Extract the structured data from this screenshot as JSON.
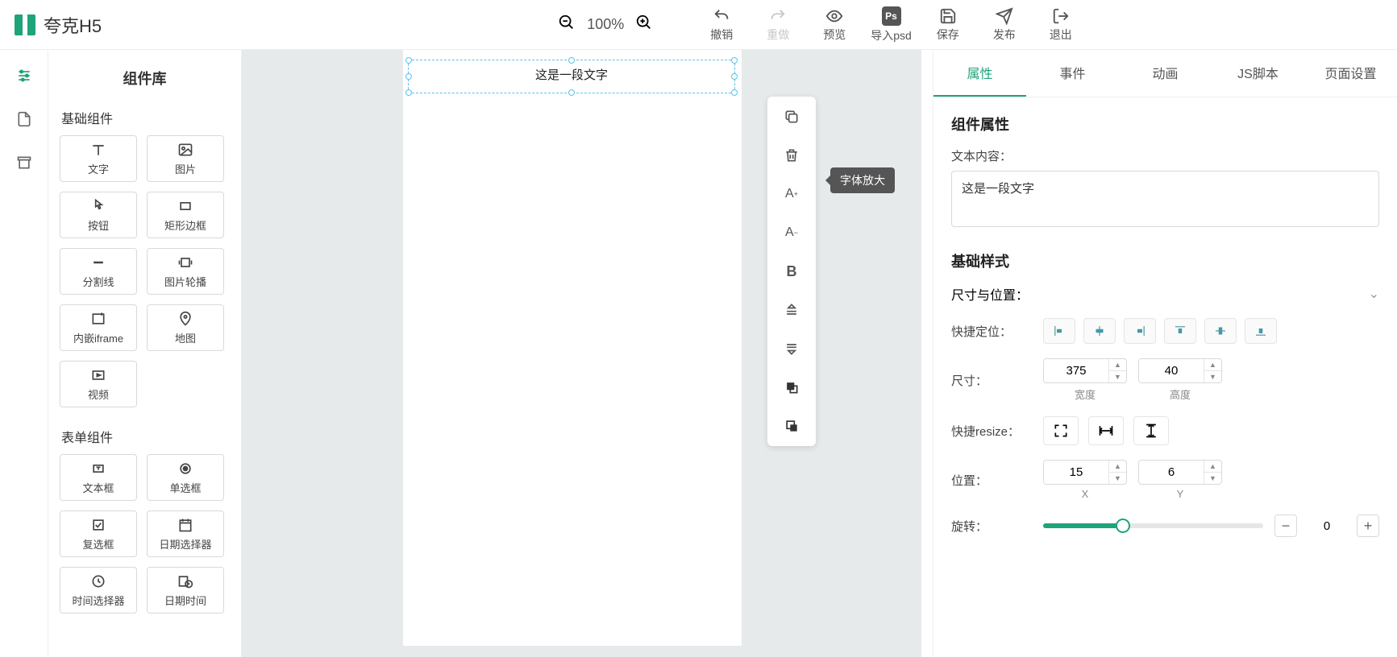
{
  "header": {
    "app_name": "夸克H5",
    "zoom": "100%",
    "buttons": {
      "undo": "撤销",
      "redo": "重做",
      "preview": "预览",
      "import_psd": "导入psd",
      "save": "保存",
      "publish": "发布",
      "exit": "退出"
    }
  },
  "comp_panel": {
    "title": "组件库",
    "group_basic": "基础组件",
    "group_form": "表单组件",
    "items_basic": [
      "文字",
      "图片",
      "按钮",
      "矩形边框",
      "分割线",
      "图片轮播",
      "内嵌iframe",
      "地图",
      "视频"
    ],
    "items_form": [
      "文本框",
      "单选框",
      "复选框",
      "日期选择器",
      "时间选择器",
      "日期时间"
    ]
  },
  "canvas": {
    "selected_text": "这是一段文字"
  },
  "float_toolbar": {
    "tooltip": "字体放大"
  },
  "prop": {
    "tabs": [
      "属性",
      "事件",
      "动画",
      "JS脚本",
      "页面设置"
    ],
    "section_component": "组件属性",
    "text_label": "文本内容：",
    "text_value": "这是一段文字",
    "section_style": "基础样式",
    "size_pos_label": "尺寸与位置：",
    "quick_pos_label": "快捷定位：",
    "size_label": "尺寸：",
    "width_value": "375",
    "width_sub": "宽度",
    "height_value": "40",
    "height_sub": "高度",
    "resize_label": "快捷resize：",
    "pos_label": "位置：",
    "x_value": "15",
    "x_sub": "X",
    "y_value": "6",
    "y_sub": "Y",
    "rotate_label": "旋转：",
    "rotate_value": "0"
  }
}
